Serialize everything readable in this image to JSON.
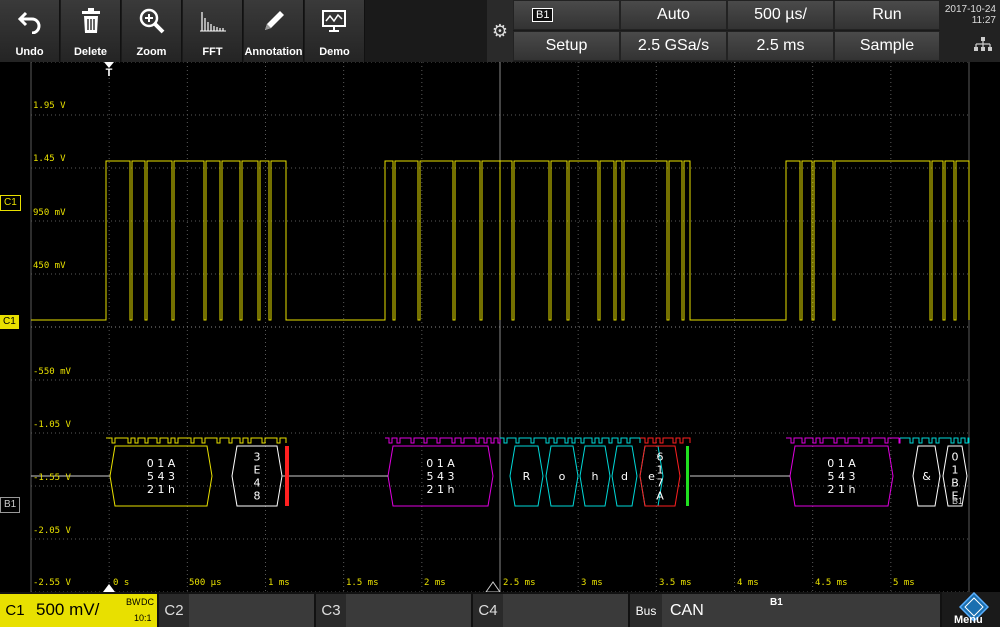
{
  "toolbar": {
    "tools": [
      {
        "label": "Undo",
        "icon": "undo-icon"
      },
      {
        "label": "Delete",
        "icon": "trash-icon"
      },
      {
        "label": "Zoom",
        "icon": "zoom-icon"
      },
      {
        "label": "FFT",
        "icon": "fft-icon"
      },
      {
        "label": "Annotation",
        "icon": "pencil-icon"
      },
      {
        "label": "Demo",
        "icon": "demo-icon"
      }
    ],
    "trigger_source": "B1",
    "trigger_mode": "Auto",
    "timebase": "500 µs/",
    "run_state": "Run",
    "setup_label": "Setup",
    "sample_rate": "2.5 GSa/s",
    "record_length": "2.5 ms",
    "acq_mode": "Sample",
    "date": "2017-10-24",
    "time": "11:27"
  },
  "screen": {
    "volt_labels": [
      "1.95 V",
      "1.45 V",
      "950 mV",
      "450 mV",
      "-550 mV",
      "-1.05 V",
      "-1.55 V",
      "-2.05 V",
      "-2.55 V"
    ],
    "time_labels": [
      "0 s",
      "500 µs",
      "1 ms",
      "1.5 ms",
      "2 ms",
      "2.5 ms",
      "3 ms",
      "3.5 ms",
      "4 ms",
      "4.5 ms",
      "5 ms"
    ],
    "trigger_marker": "T",
    "c1_level_marker": "C1",
    "c1_trigger_marker": "C1",
    "b1_marker": "B1",
    "decode_frames": [
      {
        "text": [
          "0 1 A",
          "5 4 3",
          "2 1 h"
        ],
        "color": "#e8e000"
      },
      {
        "text": [
          "3",
          "E",
          "4",
          "8"
        ],
        "color": "#ffffff"
      },
      {
        "text": [
          "0 1 A",
          "5 4 3",
          "2 1 h"
        ],
        "color": "#e000e0"
      },
      {
        "text": [
          "R"
        ],
        "color": "#00d8d8"
      },
      {
        "text": [
          "o"
        ],
        "color": "#00d8d8"
      },
      {
        "text": [
          "h"
        ],
        "color": "#00d8d8"
      },
      {
        "text": [
          "d"
        ],
        "color": "#00d8d8"
      },
      {
        "text": [
          "e"
        ],
        "color": "#00d8d8"
      },
      {
        "text": [
          "6",
          "1",
          "7",
          "A"
        ],
        "color": "#ff2020"
      },
      {
        "text": [
          "0 1 A",
          "5 4 3",
          "2 1 h"
        ],
        "color": "#e000e0"
      },
      {
        "text": [
          "&"
        ],
        "color": "#ffffff"
      },
      {
        "text": [
          "0",
          "1",
          "B",
          "E"
        ],
        "color": "#ffffff"
      }
    ],
    "b1_corner": "B1"
  },
  "bottom": {
    "c1_name": "C1",
    "c1_scale": "500 mV/",
    "c1_bw": "BW",
    "c1_coupling": "DC",
    "c1_probe": "10:1",
    "c2_name": "C2",
    "c3_name": "C3",
    "c4_name": "C4",
    "bus_name": "Bus",
    "bus_protocol": "CAN",
    "bus_id": "B1",
    "menu_label": "Menu"
  },
  "colors": {
    "ch1": "#e8e000",
    "grid": "#5a5a5a",
    "bus_magenta": "#e000e0",
    "bus_cyan": "#00d8d8",
    "bus_red": "#ff2020",
    "bus_green": "#20e020"
  }
}
